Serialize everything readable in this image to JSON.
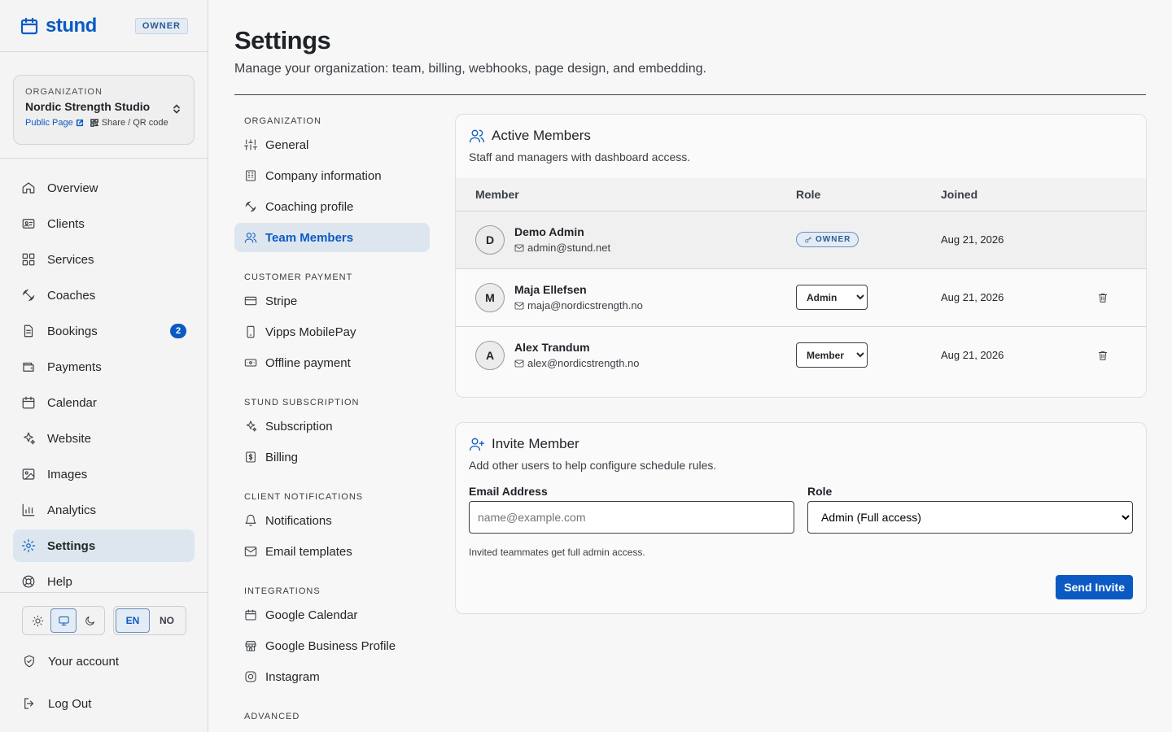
{
  "brand": {
    "name": "stund",
    "role_badge": "OWNER"
  },
  "org": {
    "label": "ORGANIZATION",
    "name": "Nordic Strength Studio",
    "public_page": "Public Page",
    "share": "Share / QR code"
  },
  "nav": {
    "overview": "Overview",
    "clients": "Clients",
    "services": "Services",
    "coaches": "Coaches",
    "bookings": "Bookings",
    "bookings_count": "2",
    "payments": "Payments",
    "calendar": "Calendar",
    "website": "Website",
    "images": "Images",
    "analytics": "Analytics",
    "settings": "Settings",
    "help": "Help"
  },
  "lang": {
    "en": "EN",
    "no": "NO"
  },
  "bottom": {
    "account": "Your account",
    "logout": "Log Out"
  },
  "page": {
    "title": "Settings",
    "subtitle": "Manage your organization: team, billing, webhooks, page design, and embedding."
  },
  "settings_nav": {
    "organization": "ORGANIZATION",
    "general": "General",
    "company": "Company information",
    "coaching": "Coaching profile",
    "team": "Team Members",
    "customer_payment": "CUSTOMER PAYMENT",
    "stripe": "Stripe",
    "vipps": "Vipps MobilePay",
    "offline": "Offline payment",
    "stund_sub": "STUND SUBSCRIPTION",
    "subscription": "Subscription",
    "billing": "Billing",
    "client_notif": "CLIENT NOTIFICATIONS",
    "notifications": "Notifications",
    "email_templates": "Email templates",
    "integrations": "INTEGRATIONS",
    "gcal": "Google Calendar",
    "gbp": "Google Business Profile",
    "instagram": "Instagram",
    "advanced": "ADVANCED"
  },
  "members_card": {
    "title": "Active Members",
    "desc": "Staff and managers with dashboard access.",
    "col_member": "Member",
    "col_role": "Role",
    "col_joined": "Joined",
    "rows": [
      {
        "initial": "D",
        "name": "Demo Admin",
        "email": "admin@stund.net",
        "role": "OWNER",
        "joined": "Aug 21, 2026"
      },
      {
        "initial": "M",
        "name": "Maja Ellefsen",
        "email": "maja@nordicstrength.no",
        "role": "Admin",
        "joined": "Aug 21, 2026"
      },
      {
        "initial": "A",
        "name": "Alex Trandum",
        "email": "alex@nordicstrength.no",
        "role": "Member",
        "joined": "Aug 21, 2026"
      }
    ],
    "role_options": [
      "Admin",
      "Member"
    ]
  },
  "invite_card": {
    "title": "Invite Member",
    "desc": "Add other users to help configure schedule rules.",
    "email_label": "Email Address",
    "email_placeholder": "name@example.com",
    "role_label": "Role",
    "role_value": "Admin (Full access)",
    "note": "Invited teammates get full admin access.",
    "send": "Send Invite"
  },
  "colors": {
    "accent": "#0b5ac4",
    "active_bg": "#dde6ef"
  }
}
